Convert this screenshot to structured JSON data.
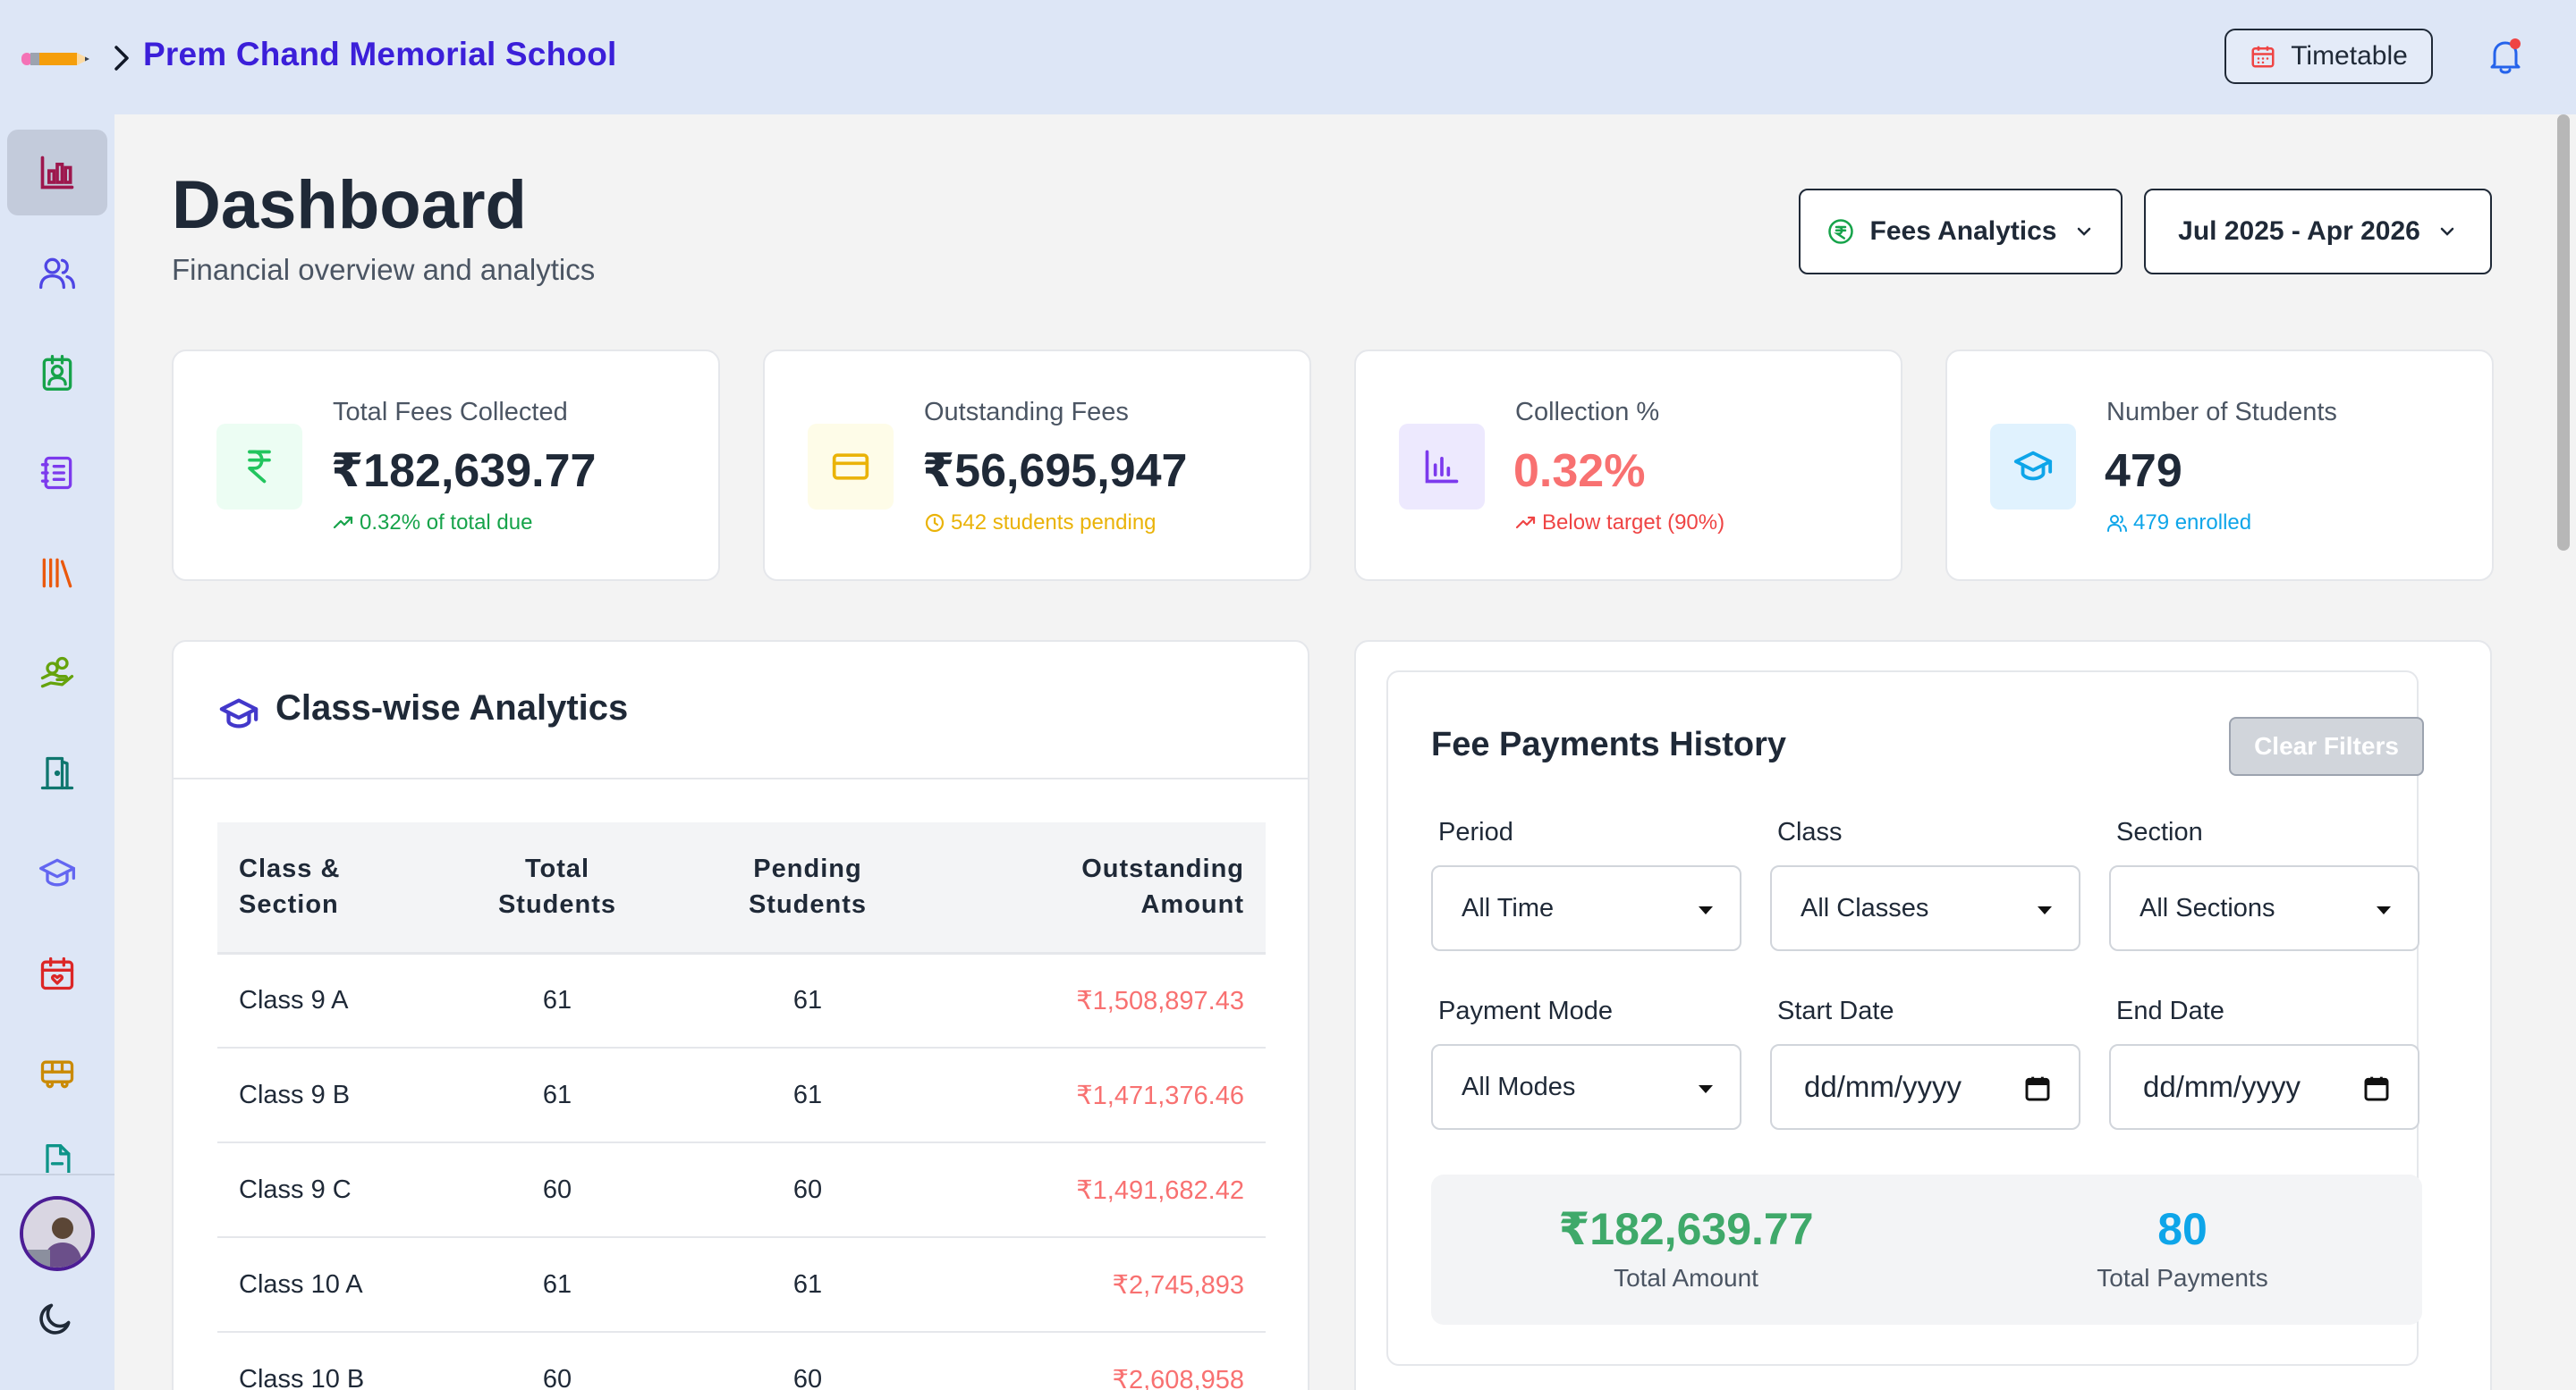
{
  "topbar": {
    "school_name": "Prem Chand Memorial School",
    "timetable_label": "Timetable"
  },
  "sidebar": {
    "items": [
      {
        "icon": "bar-chart-icon",
        "color": "#9d174d",
        "active": true
      },
      {
        "icon": "users-icon",
        "color": "#4f46e5"
      },
      {
        "icon": "id-badge-icon",
        "color": "#16a34a"
      },
      {
        "icon": "notebook-icon",
        "color": "#7c3aed"
      },
      {
        "icon": "library-icon",
        "color": "#ea580c"
      },
      {
        "icon": "hand-coins-icon",
        "color": "#65a30d"
      },
      {
        "icon": "door-icon",
        "color": "#0f766e"
      },
      {
        "icon": "graduation-cap-icon",
        "color": "#6366f1"
      },
      {
        "icon": "calendar-heart-icon",
        "color": "#dc2626"
      },
      {
        "icon": "bus-icon",
        "color": "#ca8a04"
      },
      {
        "icon": "file-icon",
        "color": "#0d9488"
      }
    ]
  },
  "header": {
    "title": "Dashboard",
    "subtitle": "Financial overview and analytics",
    "analytics_selector": "Fees Analytics",
    "range_selector": "Jul 2025 - Apr 2026"
  },
  "stats": [
    {
      "label": "Total Fees Collected",
      "value": "₹182,639.77",
      "sub": "0.32% of total due",
      "sub_color": "#16a34a",
      "icon": "rupee-icon",
      "icon_color": "#22c55e",
      "icon_bg": "#ecfdf3",
      "value_color": "#1f2937"
    },
    {
      "label": "Outstanding Fees",
      "value": "₹56,695,947",
      "sub": "542 students pending",
      "sub_color": "#eab308",
      "icon": "credit-card-icon",
      "icon_color": "#eab308",
      "icon_bg": "#fefce8",
      "value_color": "#1f2937"
    },
    {
      "label": "Collection %",
      "value": "0.32%",
      "sub": "Below target (90%)",
      "sub_color": "#ef4444",
      "icon": "bar-chart-icon",
      "icon_color": "#7c3aed",
      "icon_bg": "#ede9fe",
      "value_color": "#f87171"
    },
    {
      "label": "Number of Students",
      "value": "479",
      "sub": "479 enrolled",
      "sub_color": "#0ea5e9",
      "icon": "graduation-cap-icon",
      "icon_color": "#0ea5e9",
      "icon_bg": "#e0f2fe",
      "value_color": "#1f2937"
    }
  ],
  "class_panel": {
    "title": "Class-wise Analytics",
    "headers": {
      "class_l1": "Class &",
      "class_l2": "Section",
      "total_l1": "Total",
      "total_l2": "Students",
      "pending_l1": "Pending",
      "pending_l2": "Students",
      "amount_l1": "Outstanding",
      "amount_l2": "Amount"
    },
    "rows": [
      {
        "cls": "Class 9 A",
        "total": "61",
        "pending": "61",
        "amount": "₹1,508,897.43"
      },
      {
        "cls": "Class 9 B",
        "total": "61",
        "pending": "61",
        "amount": "₹1,471,376.46"
      },
      {
        "cls": "Class 9 C",
        "total": "60",
        "pending": "60",
        "amount": "₹1,491,682.42"
      },
      {
        "cls": "Class 10 A",
        "total": "61",
        "pending": "61",
        "amount": "₹2,745,893"
      },
      {
        "cls": "Class 10 B",
        "total": "60",
        "pending": "60",
        "amount": "₹2,608,958"
      }
    ]
  },
  "fee_panel": {
    "title": "Fee Payments History",
    "clear_label": "Clear Filters",
    "period": {
      "label": "Period",
      "value": "All Time"
    },
    "class": {
      "label": "Class",
      "value": "All Classes"
    },
    "section": {
      "label": "Section",
      "value": "All Sections"
    },
    "mode": {
      "label": "Payment Mode",
      "value": "All Modes"
    },
    "start": {
      "label": "Start Date",
      "value": "dd/mm/yyyy"
    },
    "end": {
      "label": "End Date",
      "value": "dd/mm/yyyy"
    },
    "total_amount": {
      "value": "₹182,639.77",
      "label": "Total Amount",
      "color": "#3fa96a"
    },
    "total_payments": {
      "value": "80",
      "label": "Total Payments",
      "color": "#0ea5e9"
    }
  }
}
